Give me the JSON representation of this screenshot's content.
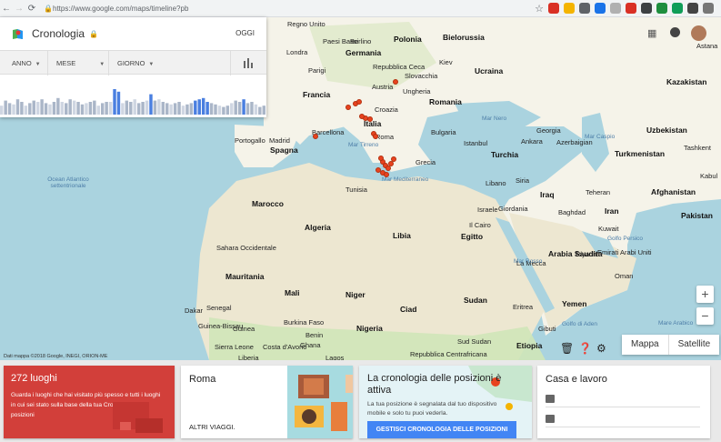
{
  "browser": {
    "url": "https://www.google.com/maps/timeline?pb",
    "back": "←",
    "forward": "→",
    "reload": "⟳",
    "lock": "🔒",
    "star": "☆",
    "extension_colors": [
      "#d93025",
      "#f4b400",
      "#5f6368",
      "#1a73e8",
      "#b0b0b0",
      "#d93025",
      "#3c4043",
      "#1e8e3e",
      "#0f9d58",
      "#444444",
      "#777777"
    ]
  },
  "timeline": {
    "title": "Cronologia",
    "today": "OGGI",
    "filters": {
      "year": "ANNO",
      "month": "MESE",
      "day": "GIORNO"
    },
    "bar_levels": [
      0.35,
      0.55,
      0.45,
      0.4,
      0.6,
      0.5,
      0.35,
      0.45,
      0.55,
      0.5,
      0.6,
      0.45,
      0.4,
      0.5,
      0.65,
      0.5,
      0.45,
      0.6,
      0.55,
      0.5,
      0.4,
      0.45,
      0.5,
      0.55,
      0.35,
      0.45,
      0.5,
      0.5,
      1.0,
      0.9,
      0.45,
      0.55,
      0.5,
      0.6,
      0.45,
      0.5,
      0.55,
      0.8,
      0.55,
      0.6,
      0.5,
      0.45,
      0.4,
      0.45,
      0.5,
      0.35,
      0.4,
      0.45,
      0.55,
      0.6,
      0.65,
      0.5,
      0.45,
      0.4,
      0.35,
      0.3,
      0.35,
      0.45,
      0.55,
      0.5,
      0.6,
      0.45,
      0.5,
      0.4,
      0.3,
      0.35
    ],
    "bar_colors": {
      "highlight": "#4a7fe0",
      "normal": "#aab6c8",
      "light": "#cfd6e2"
    }
  },
  "map": {
    "labels": [
      {
        "t": "Regno Unito"
      },
      {
        "t": "Paesi Bassi"
      },
      {
        "t": "Berlino"
      },
      {
        "t": "Polonia"
      },
      {
        "t": "Bielorussia"
      },
      {
        "t": "Londra"
      },
      {
        "t": "Germania"
      },
      {
        "t": "Kiev"
      },
      {
        "t": "Parigi"
      },
      {
        "t": "Repubblica Ceca"
      },
      {
        "t": "Slovacchia"
      },
      {
        "t": "Ucraina"
      },
      {
        "t": "Austria"
      },
      {
        "t": "Ungheria"
      },
      {
        "t": "Astana"
      },
      {
        "t": "Francia"
      },
      {
        "t": "Croazia"
      },
      {
        "t": "Romania"
      },
      {
        "t": "Kazakistan"
      },
      {
        "t": "Italia"
      },
      {
        "t": "Bulgaria"
      },
      {
        "t": "Georgia"
      },
      {
        "t": "Uzbekistan"
      },
      {
        "t": "Portogallo"
      },
      {
        "t": "Barcellona"
      },
      {
        "t": "Madrid"
      },
      {
        "t": "Roma"
      },
      {
        "t": "Istanbul"
      },
      {
        "t": "Azerbaigian"
      },
      {
        "t": "Spagna"
      },
      {
        "t": "Grecia"
      },
      {
        "t": "Ankara"
      },
      {
        "t": "Turkmenistan"
      },
      {
        "t": "Turchia"
      },
      {
        "t": "Tashkent"
      },
      {
        "t": "Kabul"
      },
      {
        "t": "Marocco"
      },
      {
        "t": "Tunisia"
      },
      {
        "t": "Siria"
      },
      {
        "t": "Afghanistan"
      },
      {
        "t": "Libano"
      },
      {
        "t": "Iraq"
      },
      {
        "t": "Teheran"
      },
      {
        "t": "Iran"
      },
      {
        "t": "Israele"
      },
      {
        "t": "Baghdad"
      },
      {
        "t": "Giordania"
      },
      {
        "t": "Algeria"
      },
      {
        "t": "Libia"
      },
      {
        "t": "Egitto"
      },
      {
        "t": "Kuwait"
      },
      {
        "t": "Pakistan"
      },
      {
        "t": "Sahara Occidentale"
      },
      {
        "t": "Il Cairo"
      },
      {
        "t": "Arabia Saudita"
      },
      {
        "t": "La Mecca"
      },
      {
        "t": "Riyadh"
      },
      {
        "t": "Emirati Arabi Uniti"
      },
      {
        "t": "Mauritania"
      },
      {
        "t": "Oman"
      },
      {
        "t": "Mali"
      },
      {
        "t": "Niger"
      },
      {
        "t": "Sudan"
      },
      {
        "t": "Eritrea"
      },
      {
        "t": "Yemen"
      },
      {
        "t": "Ciad"
      },
      {
        "t": "Dakar"
      },
      {
        "t": "Senegal"
      },
      {
        "t": "Guinea"
      },
      {
        "t": "Burkina Faso"
      },
      {
        "t": "Guinea-Bissau"
      },
      {
        "t": "Sierra Leone"
      },
      {
        "t": "Costa d'Avorio"
      },
      {
        "t": "Ghana"
      },
      {
        "t": "Benin"
      },
      {
        "t": "Nigeria"
      },
      {
        "t": "Lagos"
      },
      {
        "t": "Repubblica Centrafricana"
      },
      {
        "t": "Sud Sudan"
      },
      {
        "t": "Etiopia"
      },
      {
        "t": "Gibuti"
      },
      {
        "t": "Liberia"
      }
    ],
    "seas": [
      "Ocean Atlantico settentrionale",
      "Mar Nero",
      "Mar Tirreno",
      "Mar Mediterraneo",
      "Mar Caspio",
      "Mar Rosso",
      "Golfo Persico",
      "Golfo di Aden",
      "Mare Arabico"
    ],
    "attribution": "Dati mappa ©2018 Google, INEGI, ORION-ME",
    "controls": {
      "zoom_in": "+",
      "zoom_out": "−",
      "view_map": "Mappa",
      "view_satellite": "Satellite"
    },
    "colors": {
      "water": "#aad3df",
      "land": "#f5f3e9",
      "desert": "#ede7d1",
      "green": "#cfe6b8",
      "dot": "#e8431f"
    }
  },
  "cards": {
    "places": {
      "count": "272 luoghi",
      "text": "Guarda i luoghi che hai visitato più spesso e tutti i luoghi in cui sei stato sulla base della tua Cronologia delle posizioni"
    },
    "trip": {
      "city": "Roma",
      "more": "ALTRI VIAGGI."
    },
    "history": {
      "title": "La cronologia delle posizioni è attiva",
      "text": "La tua posizione è segnalata dal tuo dispositivo mobile e solo tu puoi vederla.",
      "button": "GESTISCI CRONOLOGIA DELLE POSIZIONI"
    },
    "home_work": {
      "title": "Casa e lavoro"
    }
  }
}
